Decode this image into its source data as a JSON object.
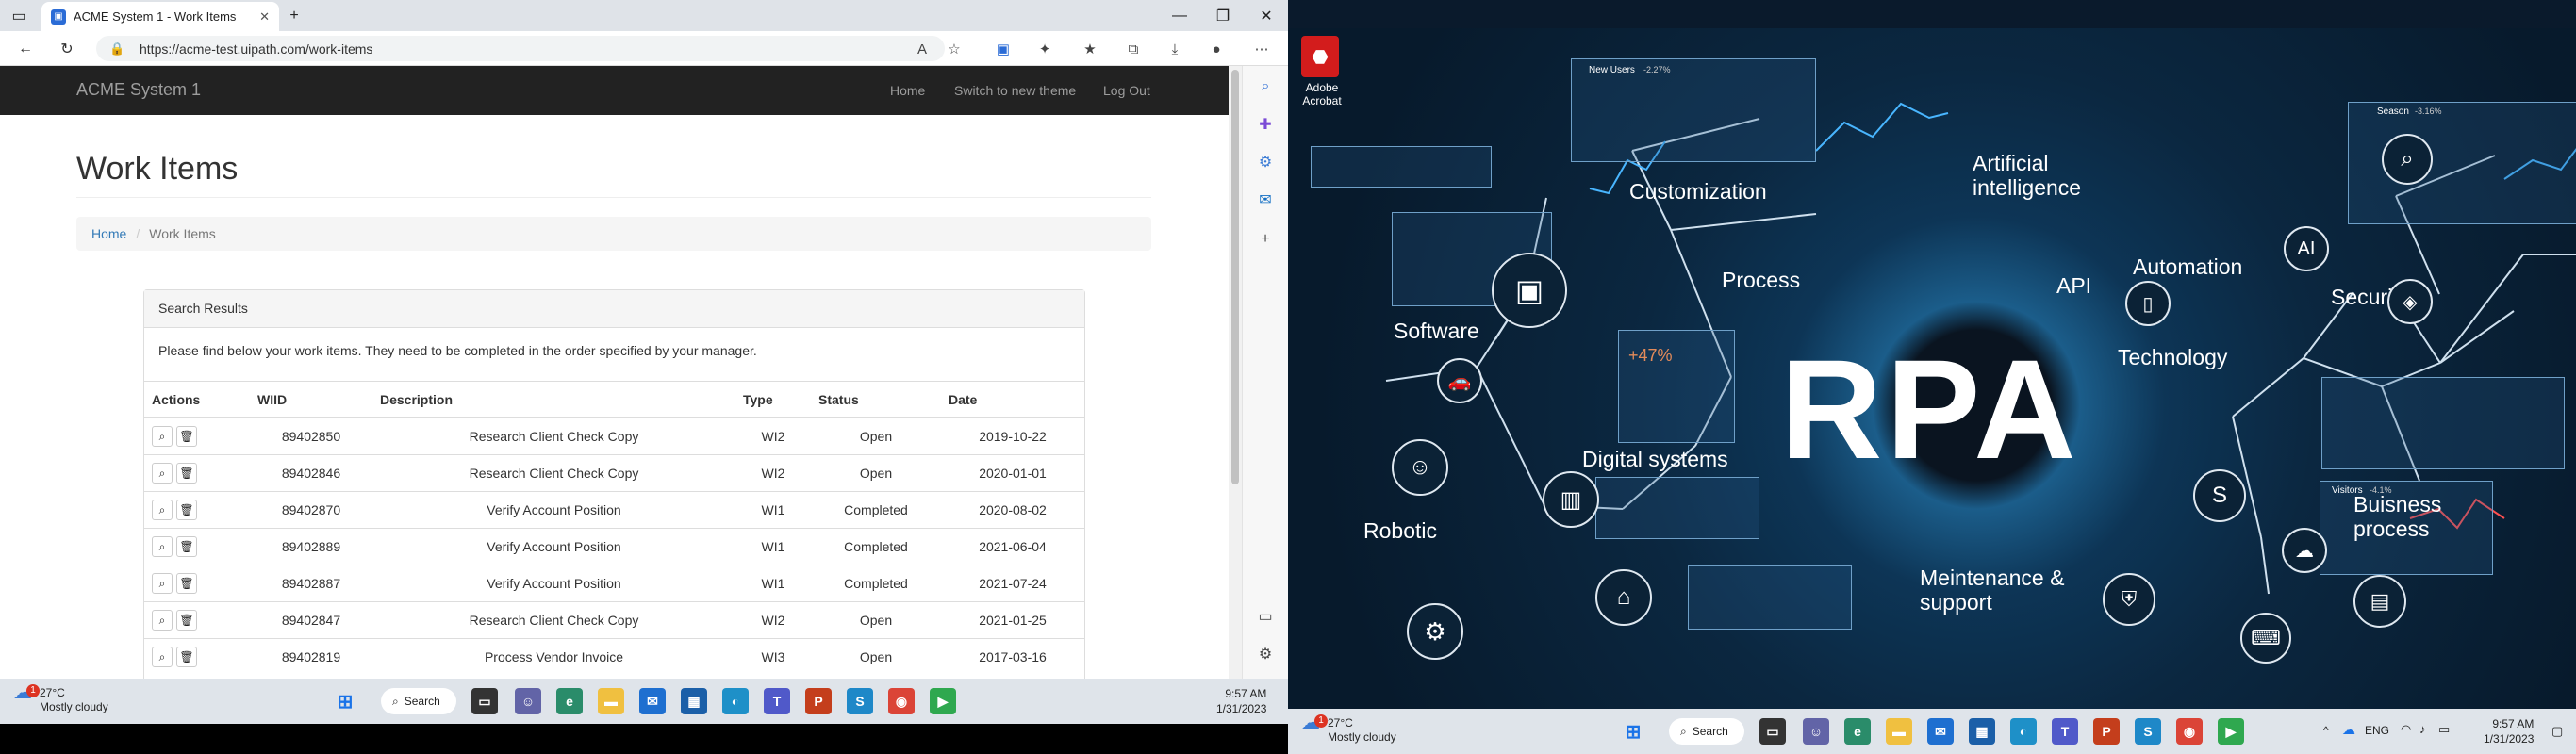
{
  "browser": {
    "tab_title": "ACME System 1 - Work Items",
    "url": "https://acme-test.uipath.com/work-items"
  },
  "site": {
    "brand": "ACME System 1",
    "nav": [
      "Home",
      "Switch to new theme",
      "Log Out"
    ],
    "page_title": "Work Items",
    "breadcrumb": {
      "home": "Home",
      "current": "Work Items"
    },
    "panel_title": "Search Results",
    "panel_text": "Please find below your work items. They need to be completed in the order specified by your manager.",
    "columns": [
      "Actions",
      "WIID",
      "Description",
      "Type",
      "Status",
      "Date"
    ],
    "rows": [
      {
        "wiid": "89402850",
        "description": "Research Client Check Copy",
        "type": "WI2",
        "status": "Open",
        "date": "2019-10-22"
      },
      {
        "wiid": "89402846",
        "description": "Research Client Check Copy",
        "type": "WI2",
        "status": "Open",
        "date": "2020-01-01"
      },
      {
        "wiid": "89402870",
        "description": "Verify Account Position",
        "type": "WI1",
        "status": "Completed",
        "date": "2020-08-02"
      },
      {
        "wiid": "89402889",
        "description": "Verify Account Position",
        "type": "WI1",
        "status": "Completed",
        "date": "2021-06-04"
      },
      {
        "wiid": "89402887",
        "description": "Verify Account Position",
        "type": "WI1",
        "status": "Completed",
        "date": "2021-07-24"
      },
      {
        "wiid": "89402847",
        "description": "Research Client Check Copy",
        "type": "WI2",
        "status": "Open",
        "date": "2021-01-25"
      },
      {
        "wiid": "89402819",
        "description": "Process Vendor Invoice",
        "type": "WI3",
        "status": "Open",
        "date": "2017-03-16"
      }
    ]
  },
  "taskbar_left": {
    "weather_temp": "27°C",
    "weather_desc": "Mostly cloudy",
    "weather_badge": "1",
    "search_label": "Search",
    "time": "9:57 AM",
    "date": "1/31/2023"
  },
  "desktop": {
    "acrobat_label": "Adobe Acrobat",
    "center_text": "RPA",
    "labels": [
      "Customization",
      "Artificial intelligence",
      "Process",
      "API",
      "Automation",
      "AI",
      "Security",
      "Software",
      "Technology",
      "Digital systems",
      "Robotic",
      "Buisness process",
      "Meintenance & support"
    ],
    "widget_new_users": "New Users",
    "widget_new_users_delta": "-2.27%",
    "widget_season": "Season",
    "widget_season_delta": "-3.16%",
    "widget_visitors": "Visitors",
    "widget_visitors_delta": "-4.1%",
    "percent_label": "+47%"
  },
  "taskbar_right": {
    "weather_temp": "27°C",
    "weather_desc": "Mostly cloudy",
    "weather_badge": "1",
    "search_label": "Search",
    "lang": "ENG",
    "time": "9:57 AM",
    "date": "1/31/2023"
  },
  "colors": {
    "navbar": "#222222",
    "link": "#337ab7",
    "taskbar": "#dfe4ea"
  }
}
